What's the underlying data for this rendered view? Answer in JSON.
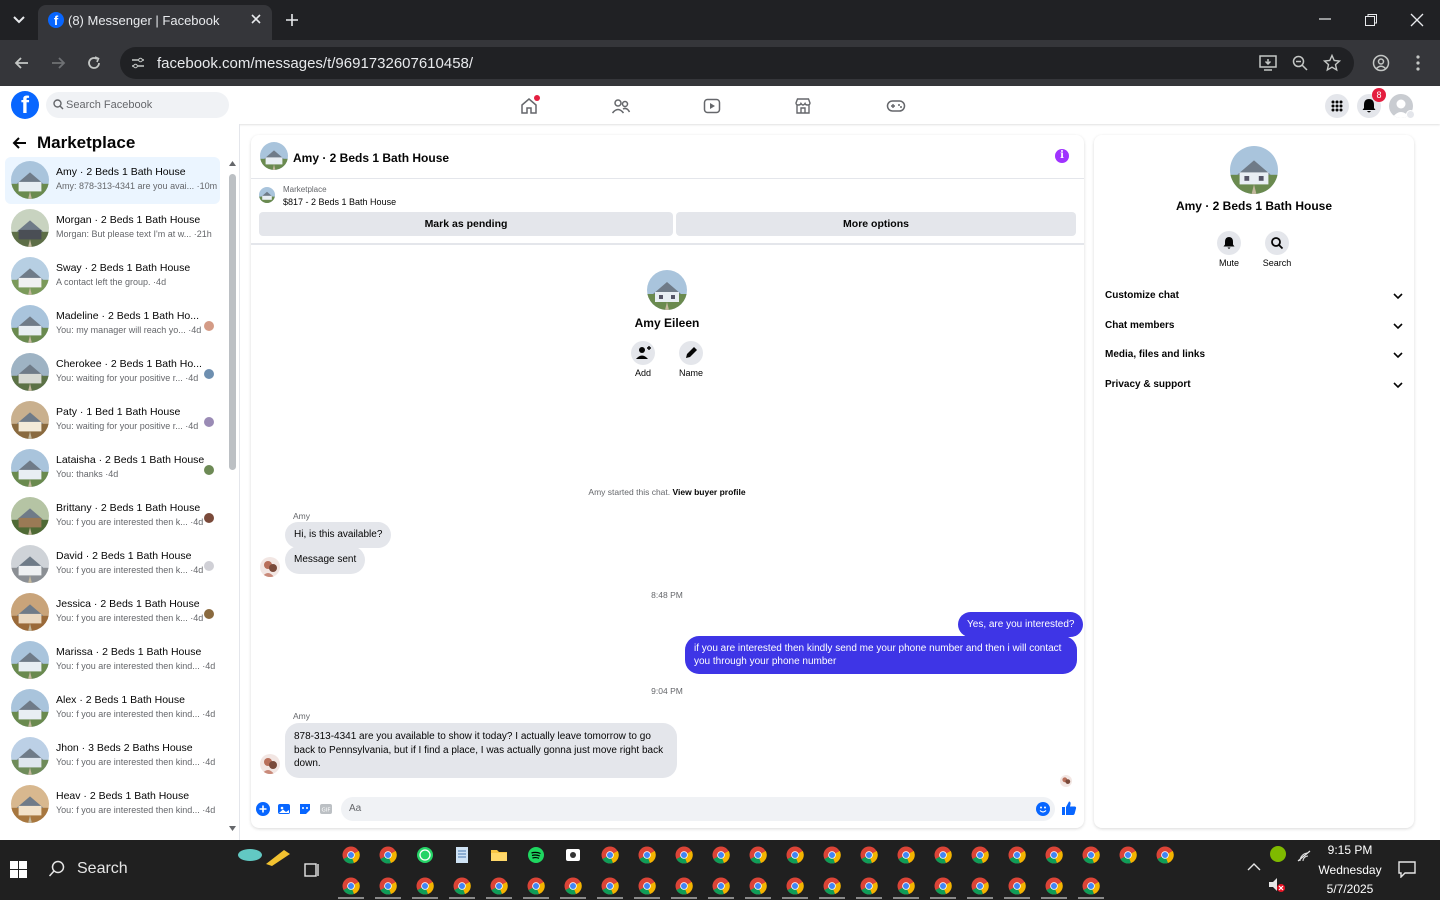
{
  "browser": {
    "tab_title": "(8) Messenger | Facebook",
    "url": "facebook.com/messages/t/9691732607610458/"
  },
  "fb": {
    "logo": "f",
    "search_placeholder": "Search Facebook",
    "notification_count": "8",
    "nav_icons": [
      "home-icon",
      "friends-icon",
      "watch-icon",
      "marketplace-icon",
      "gaming-icon"
    ]
  },
  "left": {
    "title": "Marketplace",
    "conversations": [
      {
        "name": "Amy · 2 Beds 1 Bath House",
        "preview": "Amy: 878-313-4341 are you avai... ·10m",
        "active": true
      },
      {
        "name": "Morgan · 2 Beds 1 Bath House",
        "preview": "Morgan: But please text I'm at w... ·21h"
      },
      {
        "name": "Sway · 2 Beds 1 Bath House",
        "preview": "A contact left the group. ·4d"
      },
      {
        "name": "Madeline · 2 Beds 1 Bath Ho...",
        "preview": "You: my manager will reach yo... ·4d"
      },
      {
        "name": "Cherokee · 2 Beds 1 Bath Ho...",
        "preview": "You: waiting for your positive r... ·4d"
      },
      {
        "name": "Paty · 1 Bed 1 Bath House",
        "preview": "You: waiting for your positive r... ·4d"
      },
      {
        "name": "Lataisha · 2 Beds 1 Bath House",
        "preview": "You: thanks ·4d"
      },
      {
        "name": "Brittany · 2 Beds 1 Bath House",
        "preview": "You: f you are interested then k... ·4d"
      },
      {
        "name": "David · 2 Beds 1 Bath House",
        "preview": "You: f you are interested then k... ·4d"
      },
      {
        "name": "Jessica · 2 Beds 1 Bath House",
        "preview": "You: f you are interested then k... ·4d"
      },
      {
        "name": "Marissa · 2 Beds 1 Bath House",
        "preview": "You: f you are interested then kind... ·4d"
      },
      {
        "name": "Alex · 2 Beds 1 Bath House",
        "preview": "You: f you are interested then kind... ·4d"
      },
      {
        "name": "Jhon · 3 Beds 2 Baths House",
        "preview": "You: f you are interested then kind... ·4d"
      },
      {
        "name": "Heav · 2 Beds 1 Bath House",
        "preview": "You: f you are interested then kind... ·4d"
      }
    ]
  },
  "chat": {
    "header_name": "Amy · 2 Beds 1 Bath House",
    "marketplace_label": "Marketplace",
    "listing": "$817 - 2 Beds 1 Bath House",
    "mark_pending": "Mark as pending",
    "more_options": "More options",
    "contact_name": "Amy Eileen",
    "add_label": "Add",
    "name_label": "Name",
    "started_text": "Amy started this chat.",
    "view_profile": "View buyer profile",
    "sender": "Amy",
    "msg1": "Hi, is this available?",
    "msg2": "Message sent",
    "time1": "8:48 PM",
    "out1": "Yes, are you interested?",
    "out2": "if you are interested then kindly send me your phone number and then i will contact you through your phone number",
    "time2": "9:04 PM",
    "sender2": "Amy",
    "msg3": "878-313-4341 are you available to show it today? I actually leave tomorrow to go back to Pennsylvania, but if I find a place, I was actually gonna just move right back down.",
    "composer_placeholder": "Aa"
  },
  "info": {
    "name": "Amy · 2 Beds 1 Bath House",
    "mute": "Mute",
    "search": "Search",
    "sections": [
      "Customize chat",
      "Chat members",
      "Media, files and links",
      "Privacy & support"
    ]
  },
  "taskbar": {
    "search": "Search",
    "time": "9:15 PM",
    "day": "Wednesday",
    "date": "5/7/2025"
  },
  "colors": {
    "fb_blue": "#0866ff",
    "outgoing_bubble": "#3e35e6",
    "info_purple": "#a033ff"
  }
}
